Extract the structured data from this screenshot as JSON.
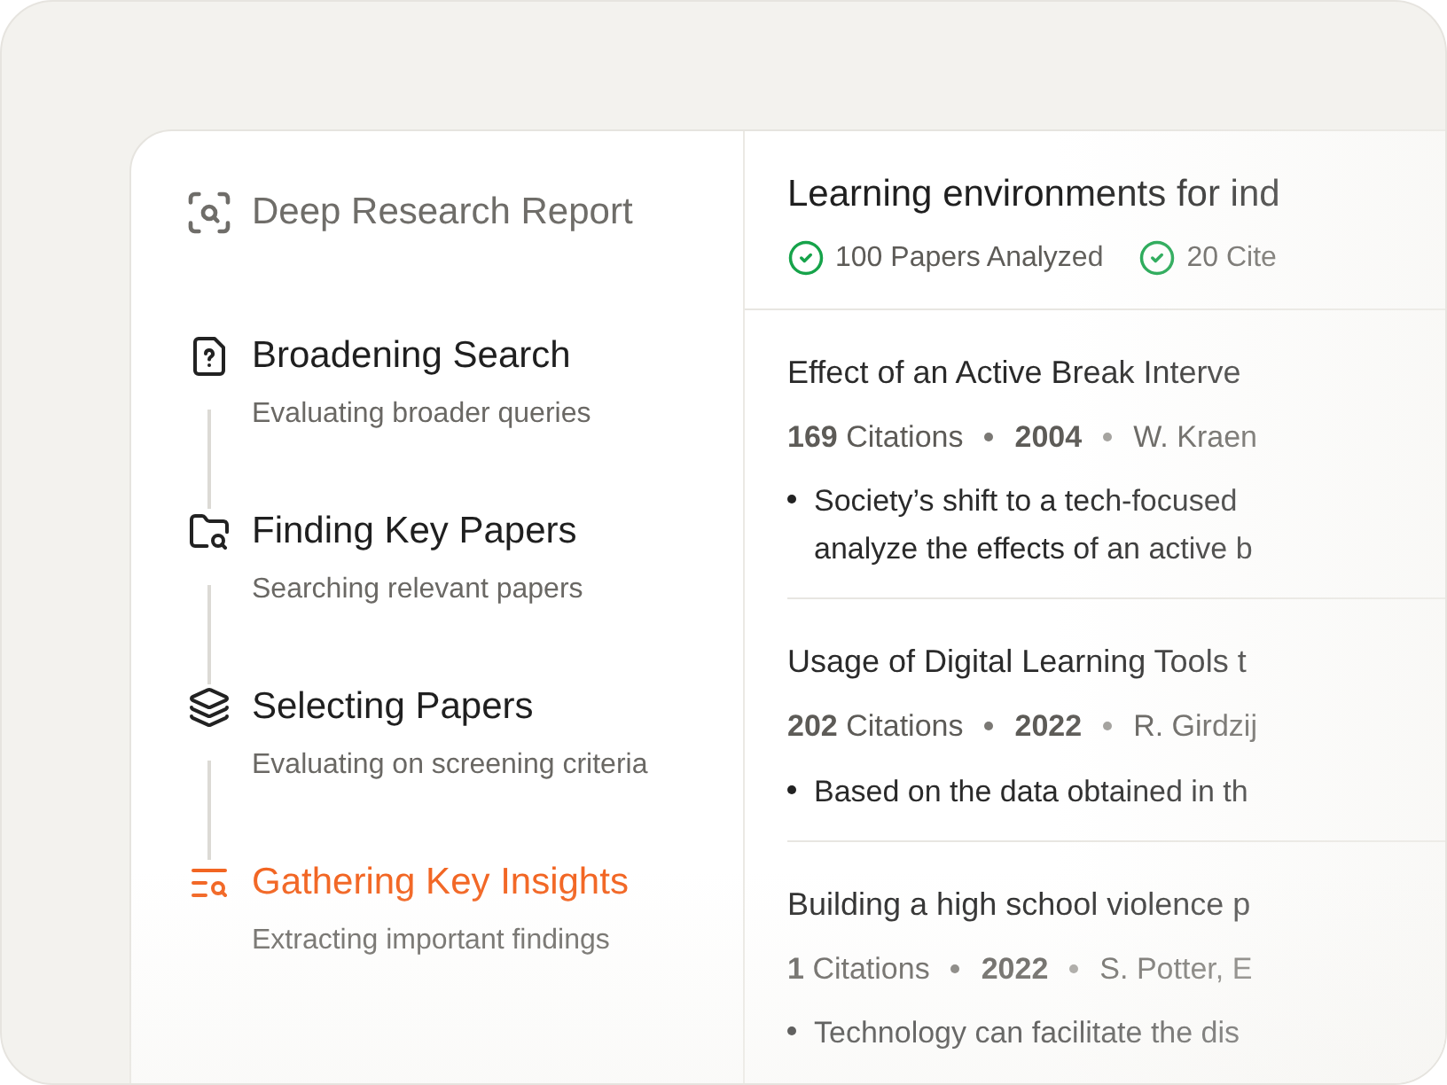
{
  "report": {
    "title": "Deep Research Report"
  },
  "steps": [
    {
      "kind": "question",
      "title": "Broadening Search",
      "subtitle": "Evaluating broader queries",
      "selected": false
    },
    {
      "kind": "folder",
      "title": "Finding Key Papers",
      "subtitle": "Searching relevant papers",
      "selected": false
    },
    {
      "kind": "layers",
      "title": "Selecting Papers",
      "subtitle": "Evaluating on screening criteria",
      "selected": false
    },
    {
      "kind": "insights",
      "title": "Gathering Key Insights",
      "subtitle": "Extracting important findings",
      "selected": true
    }
  ],
  "result": {
    "title": "Learning environments for ind",
    "stats": [
      "100 Papers Analyzed",
      "20 Cite"
    ]
  },
  "papers": [
    {
      "title": "Effect of an Active Break Interve",
      "citations": "**169** Citations",
      "year": "2004",
      "authors": "W. Kraen",
      "finding": [
        "Society’s shift to a tech-focused",
        "analyze the effects of an active b"
      ]
    },
    {
      "title": "Usage of Digital Learning Tools t",
      "citations": "**202** Citations",
      "year": "2022",
      "authors": "R. Girdzij",
      "finding": [
        "Based on the data obtained in th"
      ]
    },
    {
      "title": "Building a high school violence p",
      "citations": "**1** Citations",
      "year": "2022",
      "authors": "S. Potter, E",
      "finding": [
        "Technology can facilitate the dis"
      ]
    }
  ]
}
